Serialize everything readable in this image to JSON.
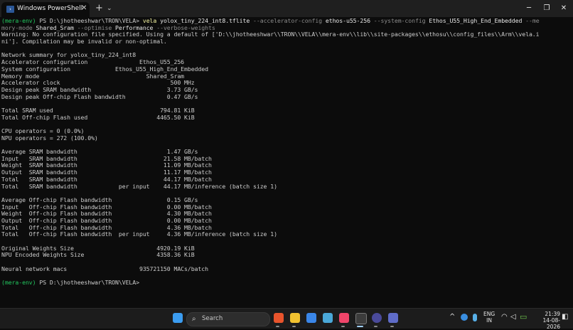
{
  "window": {
    "tab_title": "Windows PowerShell",
    "tab_icon_glyph": "›",
    "close_glyph": "✕",
    "new_tab_glyph": "+",
    "menu_glyph": "⌄",
    "minimize_glyph": "─",
    "maximize_glyph": "❐",
    "close_window_glyph": "✕"
  },
  "terminal": {
    "prompt_env": "(mera-env)",
    "prompt_path": " PS D:\\jhotheeshwar\\TRON\\VELA> ",
    "cmd_line1_parts": [
      {
        "t": "vela ",
        "c": "main"
      },
      {
        "t": "yolox_tiny_224_int8.tflite ",
        "c": "val"
      },
      {
        "t": "--accelerator-config ",
        "c": "flag"
      },
      {
        "t": "ethos-u55-256 ",
        "c": "val"
      },
      {
        "t": "--system-config ",
        "c": "flag"
      },
      {
        "t": "Ethos_U55_High_End_Embedded ",
        "c": "val"
      },
      {
        "t": "--me",
        "c": "flag"
      }
    ],
    "cmd_line2_parts": [
      {
        "t": "mory-mode ",
        "c": "flag"
      },
      {
        "t": "Shared_Sram ",
        "c": "val"
      },
      {
        "t": "--optimise ",
        "c": "flag"
      },
      {
        "t": "Performance ",
        "c": "val"
      },
      {
        "t": "--verbose-weights",
        "c": "flag"
      }
    ],
    "output_lines": [
      "Warning: No configuration file specified. Using a default of ['D:\\\\jhotheeshwar\\\\TRON\\\\VELA\\\\mera-env\\\\lib\\\\site-packages\\\\ethosu\\\\config_files\\\\Arm\\\\vela.i",
      "ni']. Compilation may be invalid or non-optimal.",
      "",
      "Network summary for yolox_tiny_224_int8",
      "Accelerator configuration               Ethos_U55_256",
      "System configuration             Ethos_U55_High_End_Embedded",
      "Memory mode                               Shared_Sram",
      "Accelerator clock                                500 MHz",
      "Design peak SRAM bandwidth                      3.73 GB/s",
      "Design peak Off-chip Flash bandwidth            0.47 GB/s",
      "",
      "Total SRAM used                               794.81 KiB",
      "Total Off-chip Flash used                    4465.50 KiB",
      "",
      "CPU operators = 0 (0.0%)",
      "NPU operators = 272 (100.0%)",
      "",
      "Average SRAM bandwidth                          1.47 GB/s",
      "Input   SRAM bandwidth                         21.58 MB/batch",
      "Weight  SRAM bandwidth                         11.09 MB/batch",
      "Output  SRAM bandwidth                         11.17 MB/batch",
      "Total   SRAM bandwidth                         44.17 MB/batch",
      "Total   SRAM bandwidth            per input    44.17 MB/inference (batch size 1)",
      "",
      "Average Off-chip Flash bandwidth                0.15 GB/s",
      "Input   Off-chip Flash bandwidth                0.00 MB/batch",
      "Weight  Off-chip Flash bandwidth                4.30 MB/batch",
      "Output  Off-chip Flash bandwidth                0.00 MB/batch",
      "Total   Off-chip Flash bandwidth                4.36 MB/batch",
      "Total   Off-chip Flash bandwidth  per input     4.36 MB/inference (batch size 1)",
      "",
      "Original Weights Size                        4920.19 KiB",
      "NPU Encoded Weights Size                     4358.36 KiB",
      "",
      "Neural network macs                     935721150 MACs/batch",
      ""
    ]
  },
  "taskbar": {
    "search_label": "Search",
    "search_glyph": "⌕",
    "apps": [
      {
        "name": "start-icon",
        "color": "#3b9cf0"
      },
      {
        "name": "brave-browser-icon",
        "color": "#e8542c"
      },
      {
        "name": "file-explorer-icon",
        "color": "#f2c230"
      },
      {
        "name": "app-store-icon",
        "color": "#3a86e8"
      },
      {
        "name": "notepad-icon",
        "color": "#4aa8d8"
      },
      {
        "name": "music-app-icon",
        "color": "#f0456a"
      },
      {
        "name": "terminal-icon",
        "color": "#3c3c3c"
      },
      {
        "name": "eclipse-icon",
        "color": "#4a4a9a"
      },
      {
        "name": "snipping-tool-icon",
        "color": "#5f6cc8"
      }
    ],
    "tray_chevron": "^",
    "language_line1": "ENG",
    "language_line2": "IN",
    "time": "21:39",
    "date": "14-08-2026",
    "wifi_glyph": "◠",
    "volume_glyph": "◁",
    "battery_glyph": "▭",
    "notification_glyph": "◧"
  },
  "colors": {
    "prompt_env": "#22c55e",
    "command": "#f2f2a0",
    "flag": "#8a8a8a",
    "text": "#cccccc",
    "background": "#0c0c0c"
  }
}
